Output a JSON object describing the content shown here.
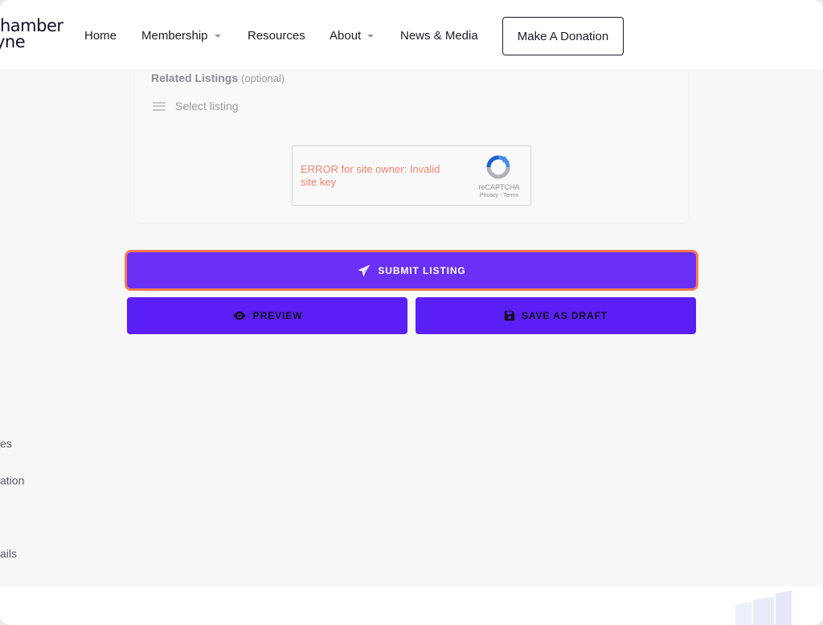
{
  "header": {
    "logo_line1": "hamber",
    "logo_line2": "yne",
    "nav": [
      {
        "label": "Home",
        "has_dropdown": false
      },
      {
        "label": "Membership",
        "has_dropdown": true
      },
      {
        "label": "Resources",
        "has_dropdown": false
      },
      {
        "label": "About",
        "has_dropdown": true
      },
      {
        "label": "News & Media",
        "has_dropdown": false
      }
    ],
    "donate_label": "Make A Donation"
  },
  "form": {
    "related_label": "Related Listings",
    "related_optional": "(optional)",
    "select_placeholder": "Select listing",
    "recaptcha": {
      "error_text": "ERROR for site owner: Invalid site key",
      "brand": "reCAPTCHA",
      "links": "Privacy - Terms"
    }
  },
  "actions": {
    "submit_label": "SUBMIT LISTING",
    "preview_label": "PREVIEW",
    "draft_label": "SAVE AS DRAFT"
  },
  "side_links": [
    "es",
    "ation",
    "ails"
  ],
  "colors": {
    "primary": "#5a1ff5",
    "focus_ring": "#ff7a50",
    "error": "#f08272"
  },
  "icons": {
    "submit": "paper-plane-icon",
    "preview": "eye-icon",
    "draft": "floppy-disk-icon",
    "select": "hamburger-icon",
    "recaptcha": "recaptcha-logo-icon"
  }
}
